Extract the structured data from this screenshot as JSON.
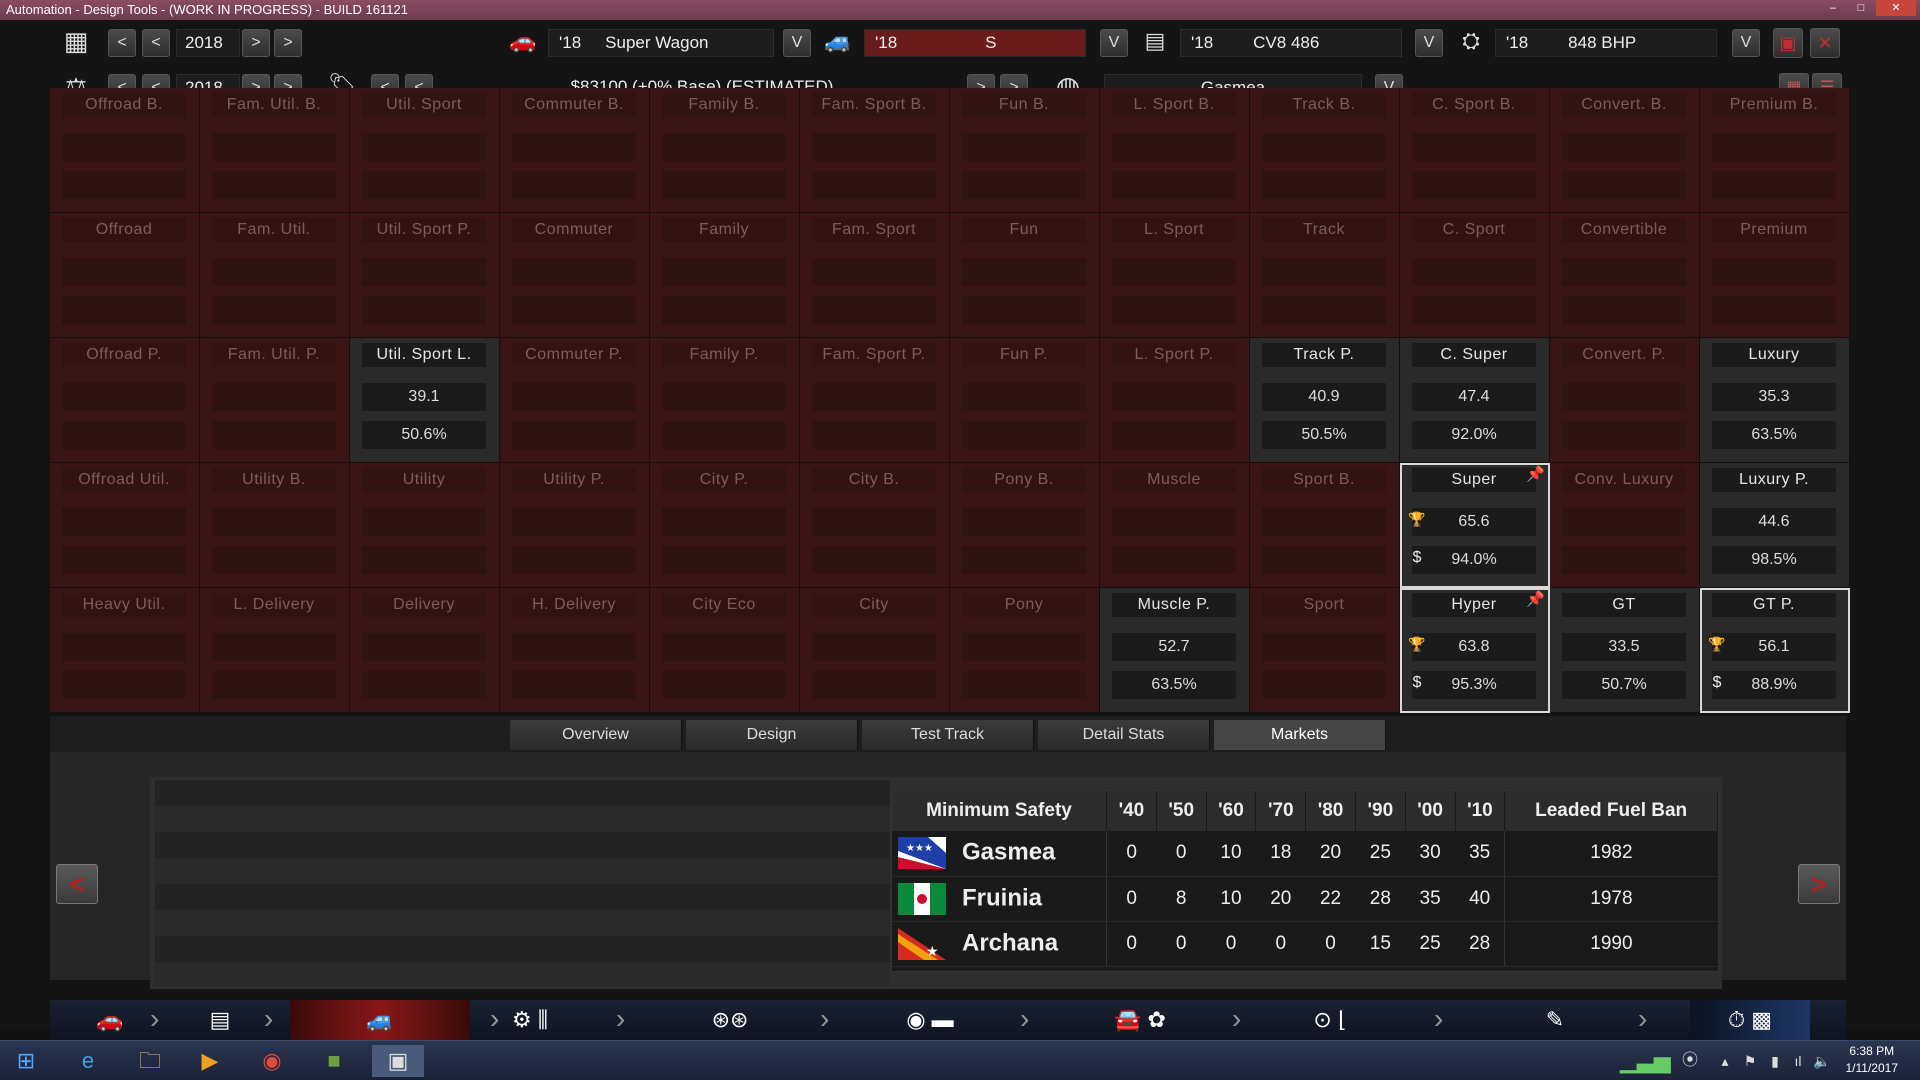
{
  "window": {
    "title": "Automation - Design Tools - (WORK IN PROGRESS) - BUILD 161121"
  },
  "toolbar": {
    "year1": "2018",
    "year2": "2018",
    "model_year": "'18",
    "model": "Super Wagon",
    "trim_year": "'18",
    "trim": "S",
    "engine_year": "'18",
    "engine": "CV8 486",
    "variant_year": "'18",
    "variant": "848 BHP",
    "price": "$83100 (+0% Base) (ESTIMATED)",
    "market": "Gasmea",
    "prev": "<",
    "next": ">",
    "dropdown": "V"
  },
  "grid": [
    [
      {
        "l": "Offroad B."
      },
      {
        "l": "Fam. Util. B."
      },
      {
        "l": "Util. Sport"
      },
      {
        "l": "Commuter B."
      },
      {
        "l": "Family B."
      },
      {
        "l": "Fam. Sport B."
      },
      {
        "l": "Fun B."
      },
      {
        "l": "L. Sport B."
      },
      {
        "l": "Track B."
      },
      {
        "l": "C. Sport B."
      },
      {
        "l": "Convert. B."
      },
      {
        "l": "Premium B."
      }
    ],
    [
      {
        "l": "Offroad"
      },
      {
        "l": "Fam. Util."
      },
      {
        "l": "Util. Sport P."
      },
      {
        "l": "Commuter"
      },
      {
        "l": "Family"
      },
      {
        "l": "Fam. Sport"
      },
      {
        "l": "Fun"
      },
      {
        "l": "L. Sport"
      },
      {
        "l": "Track"
      },
      {
        "l": "C. Sport"
      },
      {
        "l": "Convertible"
      },
      {
        "l": "Premium"
      }
    ],
    [
      {
        "l": "Offroad P."
      },
      {
        "l": "Fam. Util. P."
      },
      {
        "l": "Util. Sport L.",
        "a": "39.1",
        "b": "50.6%",
        "s": "hl"
      },
      {
        "l": "Commuter P."
      },
      {
        "l": "Family P."
      },
      {
        "l": "Fam. Sport P."
      },
      {
        "l": "Fun P."
      },
      {
        "l": "L. Sport P."
      },
      {
        "l": "Track P.",
        "a": "40.9",
        "b": "50.5%",
        "s": "hl"
      },
      {
        "l": "C. Super",
        "a": "47.4",
        "b": "92.0%",
        "s": "hl"
      },
      {
        "l": "Convert. P."
      },
      {
        "l": "Luxury",
        "a": "35.3",
        "b": "63.5%",
        "s": "hl"
      }
    ],
    [
      {
        "l": "Offroad Util."
      },
      {
        "l": "Utility B."
      },
      {
        "l": "Utility"
      },
      {
        "l": "Utility P."
      },
      {
        "l": "City P."
      },
      {
        "l": "City B."
      },
      {
        "l": "Pony B."
      },
      {
        "l": "Muscle"
      },
      {
        "l": "Sport B."
      },
      {
        "l": "Super",
        "a": "65.6",
        "b": "94.0%",
        "s": "sel",
        "pin": true
      },
      {
        "l": "Conv. Luxury"
      },
      {
        "l": "Luxury P.",
        "a": "44.6",
        "b": "98.5%",
        "s": "hl"
      }
    ],
    [
      {
        "l": "Heavy Util."
      },
      {
        "l": "L. Delivery"
      },
      {
        "l": "Delivery"
      },
      {
        "l": "H. Delivery"
      },
      {
        "l": "City Eco"
      },
      {
        "l": "City"
      },
      {
        "l": "Pony"
      },
      {
        "l": "Muscle P.",
        "a": "52.7",
        "b": "63.5%",
        "s": "hl"
      },
      {
        "l": "Sport"
      },
      {
        "l": "Hyper",
        "a": "63.8",
        "b": "95.3%",
        "s": "sel",
        "pin": true
      },
      {
        "l": "GT",
        "a": "33.5",
        "b": "50.7%",
        "s": "hl"
      },
      {
        "l": "GT P.",
        "a": "56.1",
        "b": "88.9%",
        "s": "sel",
        "trophy": true
      }
    ]
  ],
  "tabs": [
    "Overview",
    "Design",
    "Test Track",
    "Detail Stats",
    "Markets"
  ],
  "market_table": {
    "headers": [
      "Minimum Safety",
      "'40",
      "'50",
      "'60",
      "'70",
      "'80",
      "'90",
      "'00",
      "'10",
      "Leaded Fuel Ban"
    ],
    "rows": [
      {
        "country": "Gasmea",
        "values": [
          "0",
          "0",
          "10",
          "18",
          "20",
          "25",
          "30",
          "35"
        ],
        "ban": "1982"
      },
      {
        "country": "Fruinia",
        "values": [
          "0",
          "8",
          "10",
          "20",
          "22",
          "28",
          "35",
          "40"
        ],
        "ban": "1978"
      },
      {
        "country": "Archana",
        "values": [
          "0",
          "0",
          "0",
          "0",
          "0",
          "15",
          "25",
          "28"
        ],
        "ban": "1990"
      }
    ]
  },
  "clock": {
    "time": "6:38 PM",
    "date": "1/11/2017"
  }
}
